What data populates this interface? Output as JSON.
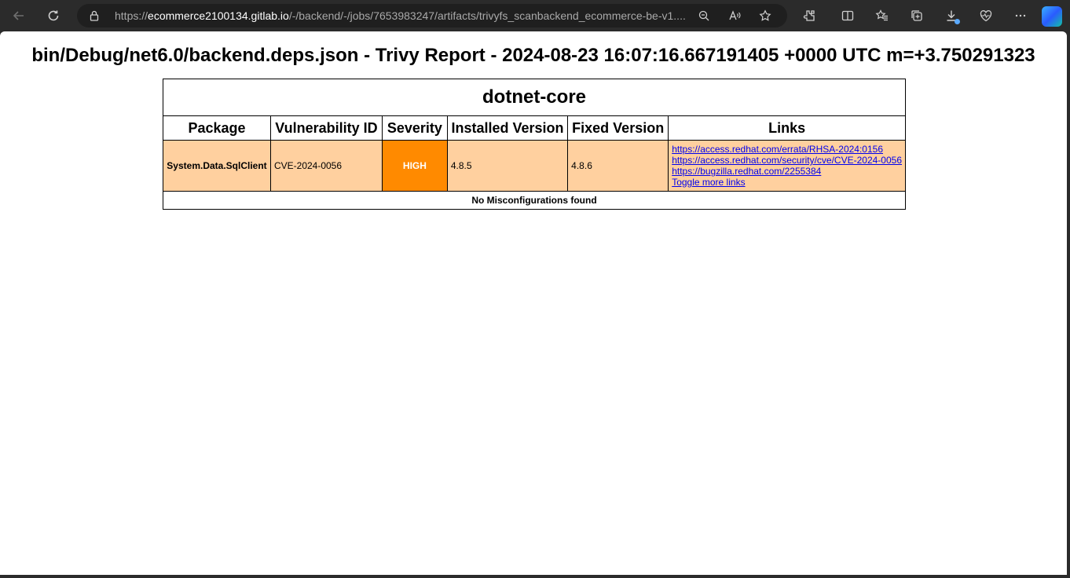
{
  "browser": {
    "url_scheme": "https://",
    "url_host": "ecommerce2100134.gitlab.io",
    "url_path": "/-/backend/-/jobs/7653983247/artifacts/trivyfs_scanbackend_ecommerce-be-v1...."
  },
  "report": {
    "title": "bin/Debug/net6.0/backend.deps.json - Trivy Report - 2024-08-23 16:07:16.667191405 +0000 UTC m=+3.750291323",
    "group": "dotnet-core",
    "columns": [
      "Package",
      "Vulnerability ID",
      "Severity",
      "Installed Version",
      "Fixed Version",
      "Links"
    ],
    "rows": [
      {
        "package": "System.Data.SqlClient",
        "vulnerability_id": "CVE-2024-0056",
        "severity": "HIGH",
        "installed_version": "4.8.5",
        "fixed_version": "4.8.6",
        "links": [
          "https://access.redhat.com/errata/RHSA-2024:0156",
          "https://access.redhat.com/security/cve/CVE-2024-0056",
          "https://bugzilla.redhat.com/2255384"
        ],
        "toggle_label": "Toggle more links"
      }
    ],
    "misconfig_text": "No Misconfigurations found"
  },
  "colors": {
    "row_background": "#ffd09f",
    "severity_high": "#ff8a00"
  }
}
